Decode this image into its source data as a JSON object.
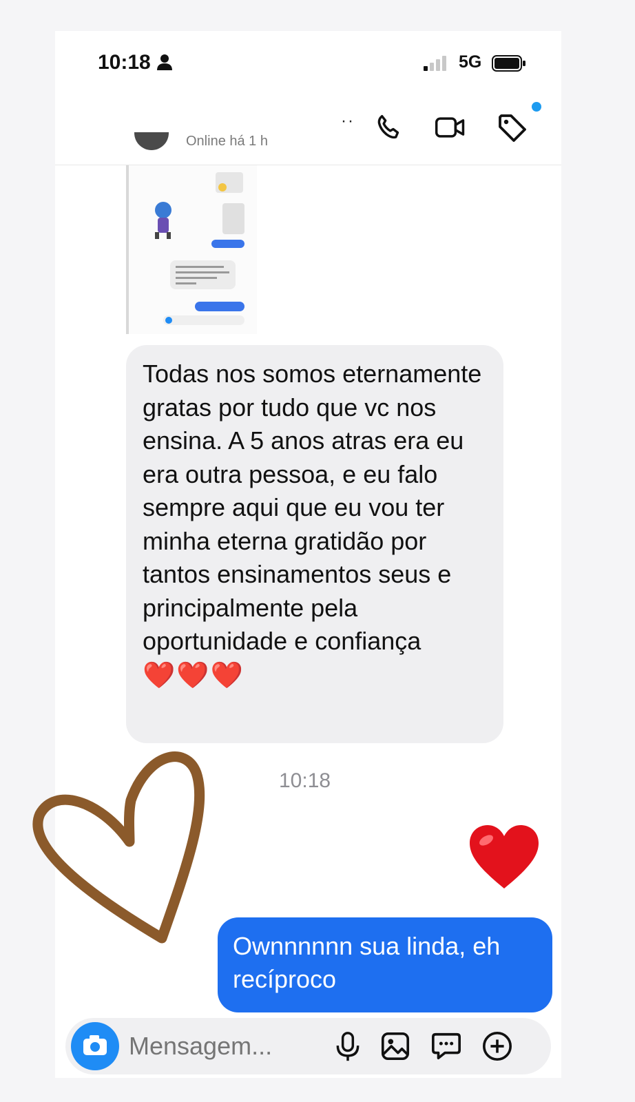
{
  "status_bar": {
    "time": "10:18",
    "network": "5G"
  },
  "header": {
    "presence": "Online há 1 h"
  },
  "messages": {
    "received_text": "Todas nos somos eternamente gratas por tudo que vc nos ensina. A 5 anos atras era eu era outra pessoa, e eu falo sempre aqui que eu vou ter minha eterna gratidão por tantos ensinamentos seus e principalmente pela oportunidade e confiança",
    "received_hearts": "❤️❤️❤️",
    "timestamp": "10:18",
    "sent_text": "Ownnnnnn sua linda, eh recíproco"
  },
  "composer": {
    "placeholder": "Mensagem..."
  },
  "icons": [
    "person-icon",
    "signal-icon",
    "battery-icon",
    "phone-icon",
    "video-icon",
    "tag-icon",
    "camera-icon",
    "mic-icon",
    "gallery-icon",
    "sticker-icon",
    "plus-icon"
  ],
  "colors": {
    "sent_bubble": "#1e6ff0",
    "received_bubble": "#efeff1",
    "heart_doodle": "#8b5a2b",
    "accent": "#1f8cf5"
  }
}
